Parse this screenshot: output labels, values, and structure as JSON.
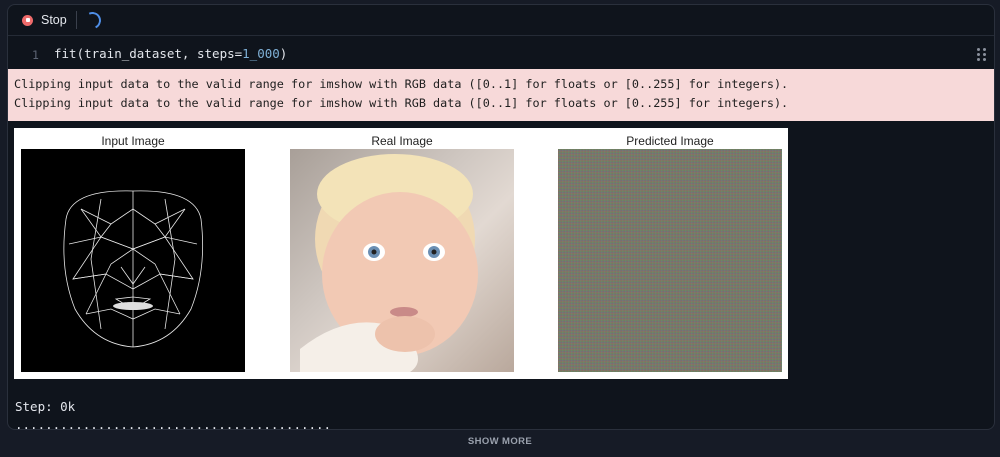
{
  "toolbar": {
    "stop_label": "Stop"
  },
  "editor": {
    "line_number": "1",
    "code_prefix": "fit(train_dataset, steps=",
    "code_number": "1_000",
    "code_suffix": ")"
  },
  "output": {
    "warnings": [
      "Clipping input data to the valid range for imshow with RGB data ([0..1] for floats or [0..255] for integers).",
      "Clipping input data to the valid range for imshow with RGB data ([0..1] for floats or [0..255] for integers)."
    ],
    "figure_titles": [
      "Input Image",
      "Real Image",
      "Predicted Image"
    ],
    "step_text": "Step: 0k",
    "progress_dots": ".........................................."
  },
  "footer": {
    "show_more_label": "SHOW MORE"
  },
  "colors": {
    "accent_blue": "#4f8fe8",
    "stop_red": "#ee6b6b",
    "warning_bg": "#f7d9d9"
  }
}
